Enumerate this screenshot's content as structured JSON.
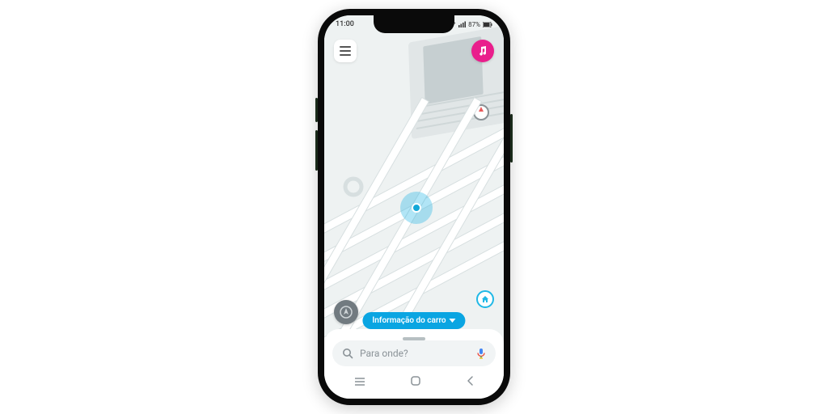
{
  "status": {
    "time": "11:00",
    "battery_pct": "87%"
  },
  "buttons": {
    "menu_name": "menu",
    "music_name": "music",
    "recenter_name": "recenter",
    "home_hint_name": "home"
  },
  "car_info": {
    "label": "Informação do carro"
  },
  "search": {
    "placeholder": "Para onde?"
  },
  "icons": {
    "search": "search",
    "voice": "voice",
    "compass": "compass",
    "location": "current-location"
  },
  "colors": {
    "accent": "#0aa5e2",
    "music": "#e91e8c",
    "map_bg": "#eef2f2"
  }
}
